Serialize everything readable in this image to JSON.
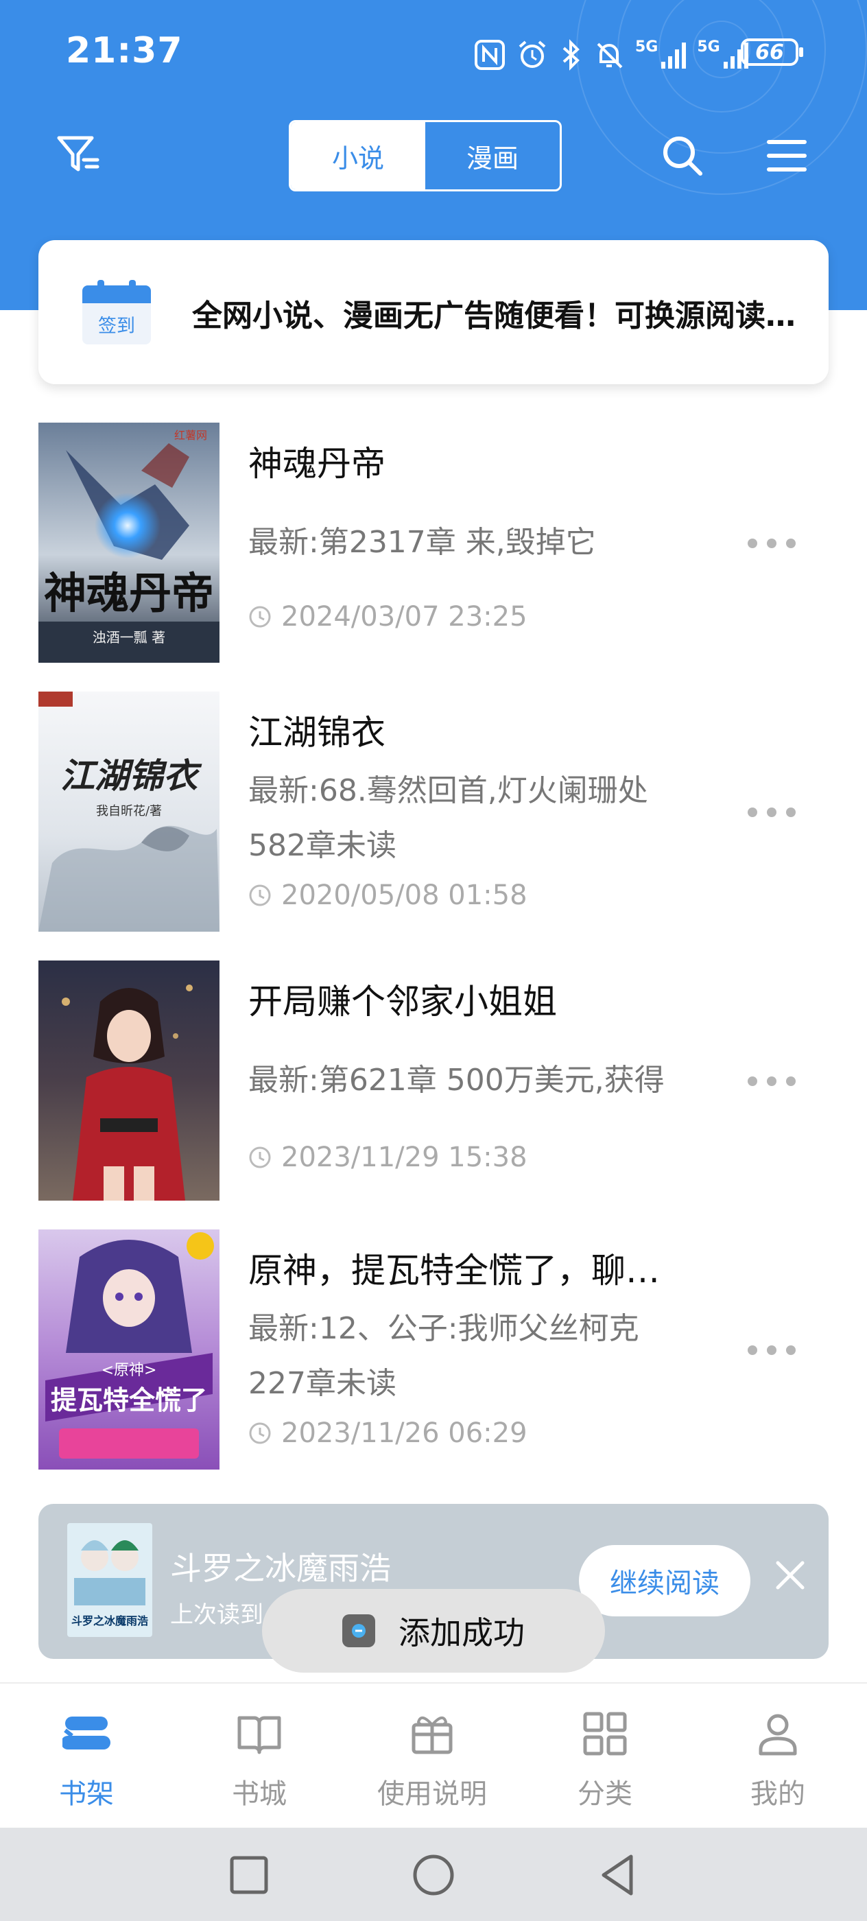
{
  "status_bar": {
    "time": "21:37",
    "net1": "5G",
    "net2": "5G",
    "battery": "66"
  },
  "header": {
    "segments": [
      "小说",
      "漫画"
    ],
    "active_segment": "小说",
    "accent_color": "#3a8de8"
  },
  "notice": {
    "icon_label": "签到",
    "text": "全网小说、漫画无广告随便看！可换源阅读，看书超方便"
  },
  "books": [
    {
      "title": "神魂丹帝",
      "latest": "最新:第2317章 来,毁掉它",
      "unread": "",
      "date": "2024/03/07 23:25",
      "cover_text": "神魂丹帝",
      "cover_author": "浊酒一瓢 著",
      "cover_badge": "红薯网"
    },
    {
      "title": "江湖锦衣",
      "latest": "最新:68.蓦然回首,灯火阑珊处",
      "unread": "582章未读",
      "date": "2020/05/08 01:58",
      "cover_text": "江湖锦衣",
      "cover_author": "我自昕花/著",
      "cover_badge": ""
    },
    {
      "title": "开局赚个邻家小姐姐",
      "latest": "最新:第621章 500万美元,获得",
      "unread": "",
      "date": "2023/11/29 15:38",
      "cover_text": "",
      "cover_author": "",
      "cover_badge": ""
    },
    {
      "title": "原神，提瓦特全慌了，聊天群出现",
      "latest": "最新:12、公子:我师父丝柯克",
      "unread": "227章未读",
      "date": "2023/11/26 06:29",
      "cover_text": "提瓦特全慌了",
      "cover_author": "<原神>",
      "cover_badge": ""
    }
  ],
  "recent": {
    "title": "斗罗之冰魔雨浩",
    "subtitle": "上次读到",
    "button": "继续阅读",
    "thumb_text": "斗罗之冰魔雨浩"
  },
  "toast": {
    "text": "添加成功"
  },
  "tabs": [
    {
      "label": "书架",
      "icon": "bookshelf-icon",
      "active": true
    },
    {
      "label": "书城",
      "icon": "book-open-icon",
      "active": false
    },
    {
      "label": "使用说明",
      "icon": "gift-icon",
      "active": false
    },
    {
      "label": "分类",
      "icon": "grid-icon",
      "active": false
    },
    {
      "label": "我的",
      "icon": "person-icon",
      "active": false
    }
  ]
}
